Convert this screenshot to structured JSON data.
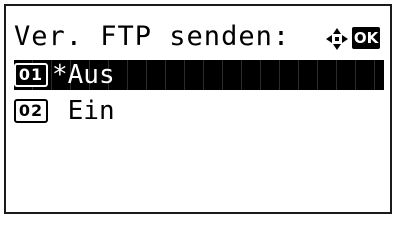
{
  "screen": {
    "title": "Ver. FTP senden:",
    "ok_label": "OK",
    "nav_icon": "four-way-arrow-icon"
  },
  "options": [
    {
      "number": "01",
      "label": "*Aus",
      "selected": true
    },
    {
      "number": "02",
      "label": " Ein",
      "selected": false
    }
  ],
  "colors": {
    "foreground": "#000000",
    "background": "#ffffff",
    "highlight": "#000000"
  }
}
